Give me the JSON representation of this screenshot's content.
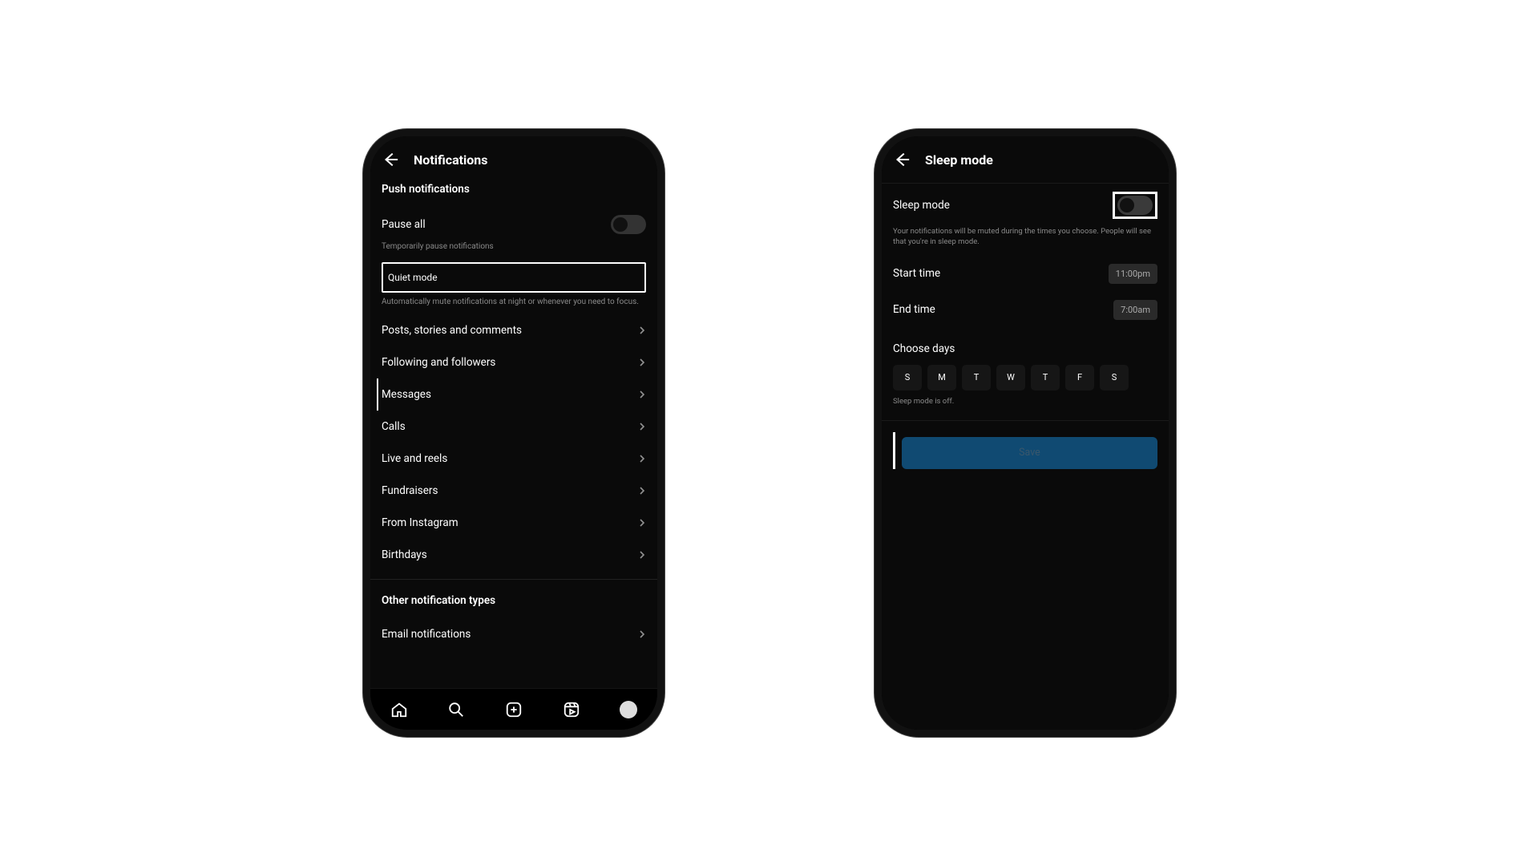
{
  "phone1": {
    "title": "Notifications",
    "push_heading": "Push notifications",
    "pause_all": "Pause all",
    "pause_sub": "Temporarily pause notifications",
    "quiet_mode": "Quiet mode",
    "quiet_sub": "Automatically mute notifications at night or whenever you need to focus.",
    "menu": [
      "Posts, stories and comments",
      "Following and followers",
      "Messages",
      "Calls",
      "Live and reels",
      "Fundraisers",
      "From Instagram",
      "Birthdays"
    ],
    "other_heading": "Other notification types",
    "email": "Email notifications"
  },
  "phone2": {
    "title": "Sleep mode",
    "toggle_label": "Sleep mode",
    "desc": "Your notifications will be muted during the times you choose. People will see that you're in sleep mode.",
    "start_label": "Start time",
    "start_value": "11:00pm",
    "end_label": "End time",
    "end_value": "7:00am",
    "choose_days": "Choose days",
    "days": [
      "S",
      "M",
      "T",
      "W",
      "T",
      "F",
      "S"
    ],
    "status": "Sleep mode is off.",
    "save": "Save"
  }
}
